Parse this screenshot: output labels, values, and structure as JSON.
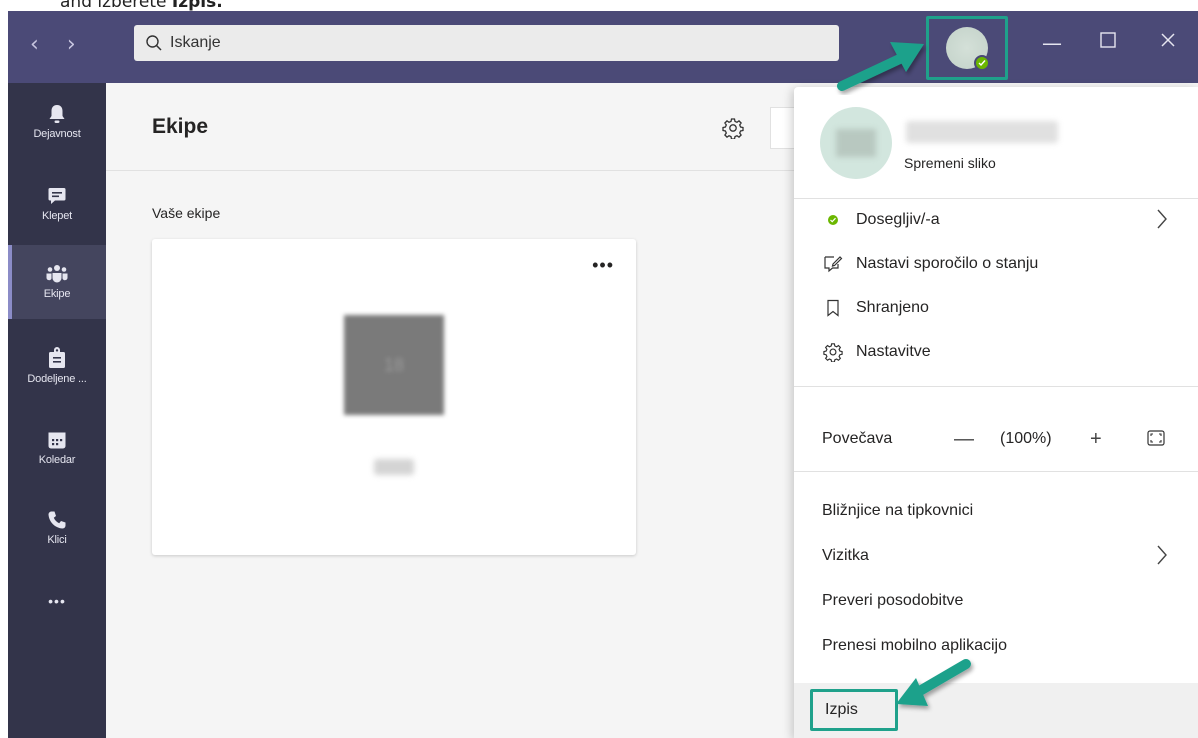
{
  "instruction": {
    "prefix": "and izberete ",
    "bold": "Izpis."
  },
  "titlebar": {
    "back_icon": "chevron-left-icon",
    "forward_icon": "chevron-right-icon",
    "search_placeholder": "Iskanje",
    "window_controls": [
      "minimize-icon",
      "maximize-icon",
      "close-icon"
    ]
  },
  "rail": {
    "items": [
      {
        "label": "Dejavnost",
        "icon": "bell-icon"
      },
      {
        "label": "Klepet",
        "icon": "chat-icon"
      },
      {
        "label": "Ekipe",
        "icon": "teams-icon",
        "active": true
      },
      {
        "label": "Dodeljene ...",
        "icon": "assignments-icon"
      },
      {
        "label": "Koledar",
        "icon": "calendar-icon"
      },
      {
        "label": "Klici",
        "icon": "phone-icon"
      }
    ],
    "more_label": "•••"
  },
  "main": {
    "title": "Ekipe",
    "section_label": "Vaše ekipe",
    "card_more": "•••",
    "team_initials": "18"
  },
  "menu": {
    "change_photo": "Spremeni sliko",
    "status": "Dosegljiv/-a",
    "set_status_message": "Nastavi sporočilo o stanju",
    "saved": "Shranjeno",
    "settings": "Nastavitve",
    "zoom_label": "Povečava",
    "zoom_minus": "—",
    "zoom_value": "(100%)",
    "zoom_plus": "+",
    "keyboard_shortcuts": "Bližnjice na tipkovnici",
    "business_card": "Vizitka",
    "check_updates": "Preveri posodobitve",
    "download_mobile": "Prenesi mobilno aplikacijo",
    "sign_out": "Izpis"
  },
  "colors": {
    "titlebar": "#4b4a77",
    "rail": "#33344a",
    "highlight": "#1fa18b",
    "available": "#6bb700"
  }
}
